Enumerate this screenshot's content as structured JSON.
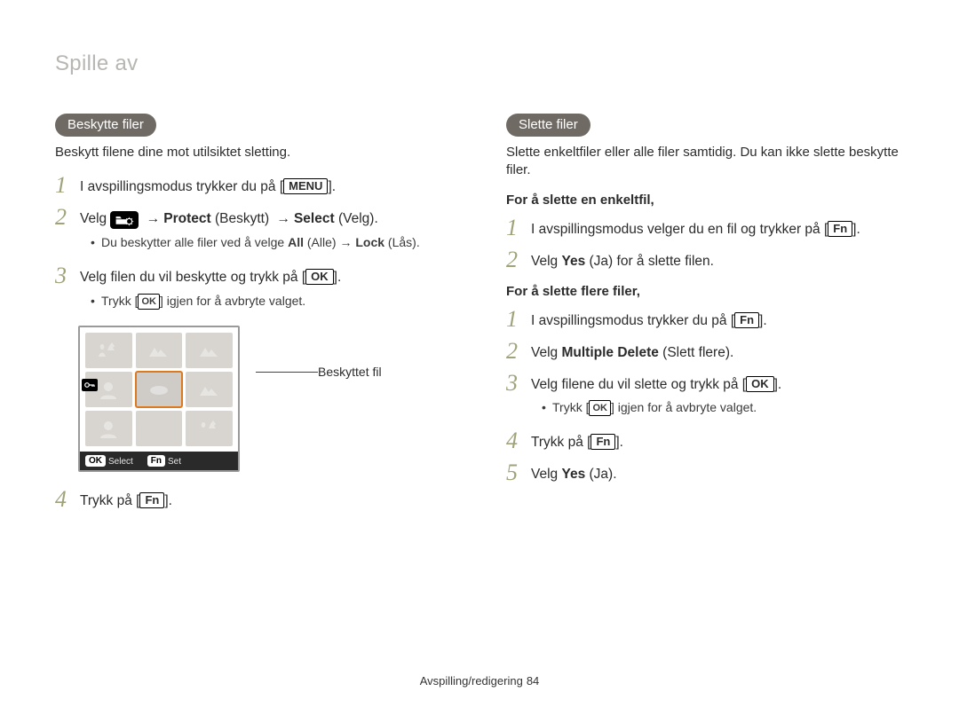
{
  "header": "Spille av",
  "left": {
    "pill": "Beskytte filer",
    "intro": "Beskytt filene dine mot utilsiktet sletting.",
    "s1": "I avspillingsmodus trykker du på [",
    "s1_btn": "MENU",
    "s1_end": "].",
    "s2_a": "Velg ",
    "s2_protect": "Protect",
    "s2_protect_paren": " (Beskytt) ",
    "s2_select": "Select",
    "s2_select_paren": " (Velg).",
    "s2_sub_a": "Du beskytter alle filer ved å velge ",
    "s2_sub_all": "All",
    "s2_sub_all_paren": " (Alle) → ",
    "s2_sub_lock": "Lock",
    "s2_sub_lock_paren": " (Lås).",
    "s3": "Velg filen du vil beskytte og trykk på [",
    "s3_btn": "OK",
    "s3_end": "].",
    "s3_sub_a": "Trykk [",
    "s3_sub_btn": "OK",
    "s3_sub_b": "] igjen for å avbryte valget.",
    "callout": "Beskyttet fil",
    "lcd_ok": "OK",
    "lcd_select": "Select",
    "lcd_fn": "Fn",
    "lcd_set": "Set",
    "s4": "Trykk på [",
    "s4_btn": "Fn",
    "s4_end": "]."
  },
  "right": {
    "pill": "Slette filer",
    "intro": "Slette enkeltfiler eller alle filer samtidig. Du kan ikke slette beskytte filer.",
    "sub1": "For å slette en enkeltfil,",
    "a1": "I avspillingsmodus velger du en fil og trykker på [",
    "a1_btn": "Fn",
    "a1_end": "].",
    "a2_a": "Velg ",
    "a2_yes": "Yes",
    "a2_b": " (Ja) for å slette filen.",
    "sub2": "For å slette flere filer,",
    "b1": "I avspillingsmodus trykker du på [",
    "b1_btn": "Fn",
    "b1_end": "].",
    "b2_a": "Velg ",
    "b2_md": "Multiple Delete",
    "b2_b": " (Slett flere).",
    "b3": "Velg filene du vil slette og trykk på [",
    "b3_btn": "OK",
    "b3_end": "].",
    "b3_sub_a": "Trykk [",
    "b3_sub_btn": "OK",
    "b3_sub_b": "] igjen for å avbryte valget.",
    "b4": "Trykk på [",
    "b4_btn": "Fn",
    "b4_end": "].",
    "b5_a": "Velg ",
    "b5_yes": "Yes",
    "b5_b": " (Ja)."
  },
  "footer": {
    "section": "Avspilling/redigering",
    "page": "84"
  }
}
